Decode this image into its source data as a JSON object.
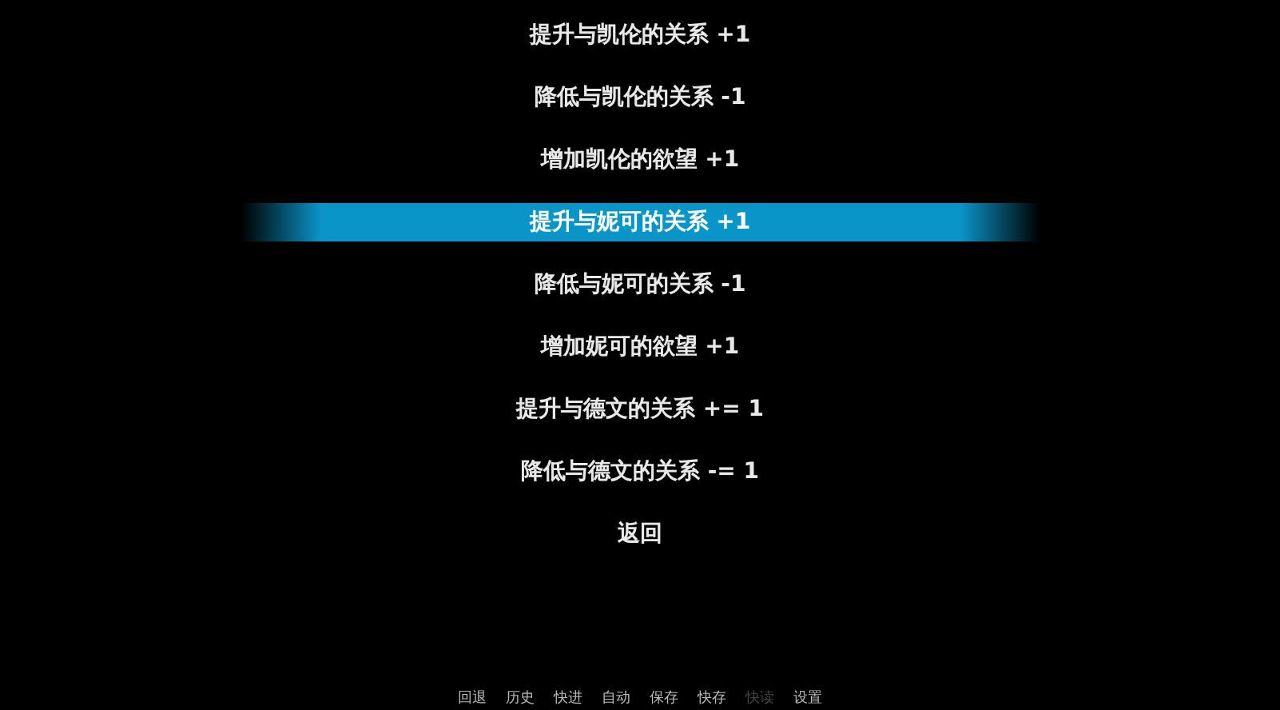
{
  "choices": [
    {
      "label": "提升与凯伦的关系 +1",
      "selected": false
    },
    {
      "label": "降低与凯伦的关系 -1",
      "selected": false
    },
    {
      "label": "增加凯伦的欲望 +1",
      "selected": false
    },
    {
      "label": "提升与妮可的关系 +1",
      "selected": true
    },
    {
      "label": "降低与妮可的关系 -1",
      "selected": false
    },
    {
      "label": "增加妮可的欲望 +1",
      "selected": false
    },
    {
      "label": "提升与德文的关系 += 1",
      "selected": false
    },
    {
      "label": "降低与德文的关系 -= 1",
      "selected": false
    },
    {
      "label": "返回",
      "selected": false
    }
  ],
  "quick_menu": [
    {
      "label": "回退",
      "disabled": false
    },
    {
      "label": "历史",
      "disabled": false
    },
    {
      "label": "快进",
      "disabled": false
    },
    {
      "label": "自动",
      "disabled": false
    },
    {
      "label": "保存",
      "disabled": false
    },
    {
      "label": "快存",
      "disabled": false
    },
    {
      "label": "快读",
      "disabled": true
    },
    {
      "label": "设置",
      "disabled": false
    }
  ]
}
